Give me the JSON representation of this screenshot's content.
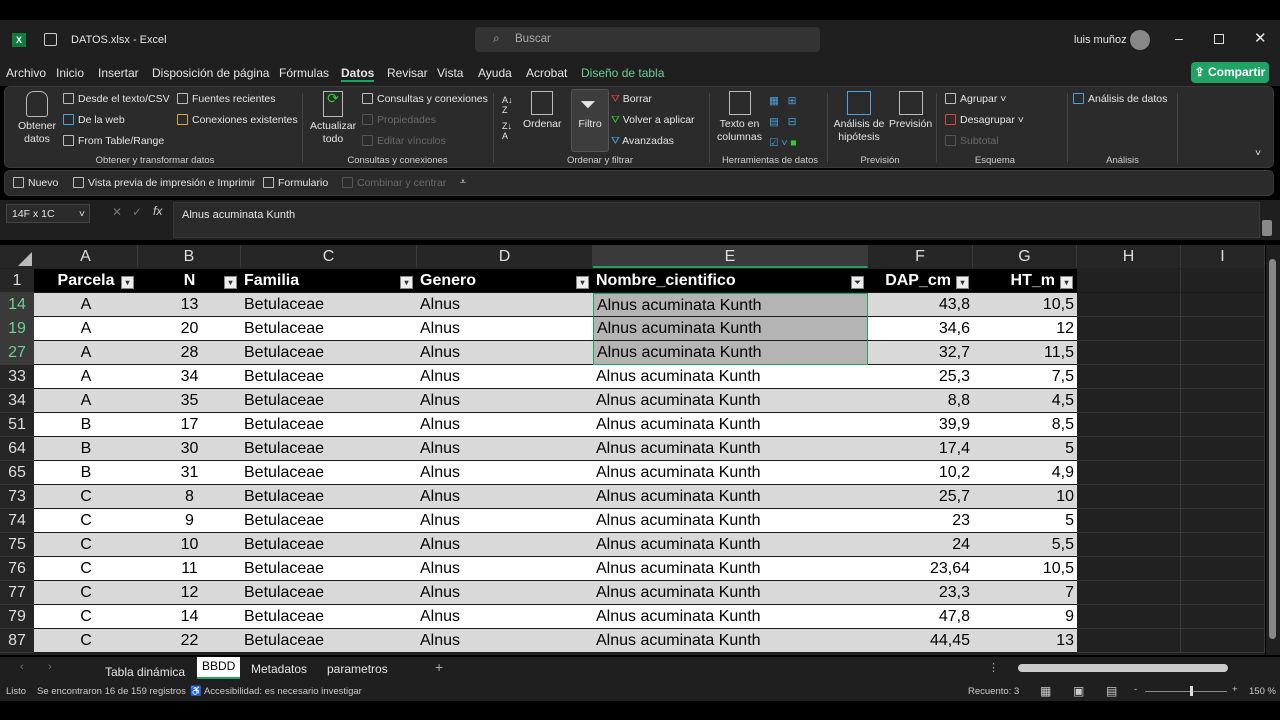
{
  "titlebar": {
    "filename": "DATOS.xlsx",
    "app": "Excel",
    "search_placeholder": "Buscar",
    "user": "luis muñoz"
  },
  "menu": [
    "Archivo",
    "Inicio",
    "Insertar",
    "Disposición de página",
    "Fórmulas",
    "Datos",
    "Revisar",
    "Vista",
    "Ayuda",
    "Acrobat",
    "Diseño de tabla"
  ],
  "share": "Compartir",
  "ribbon": {
    "obtener": "Obtener datos",
    "desde_texto": "Desde el texto/CSV",
    "de_web": "De la web",
    "from_table": "From Table/Range",
    "fuentes": "Fuentes recientes",
    "conexiones": "Conexiones existentes",
    "grp1": "Obtener y transformar datos",
    "actualizar": "Actualizar todo",
    "consultas": "Consultas y conexiones",
    "propiedades": "Propiedades",
    "editar": "Editar vínculos",
    "grp2": "Consultas y conexiones",
    "ordenar": "Ordenar",
    "filtro": "Filtro",
    "borrar": "Borrar",
    "volver": "Volver a aplicar",
    "avanzadas": "Avanzadas",
    "grp3": "Ordenar y filtrar",
    "texto_col": "Texto en columnas",
    "grp4": "Herramientas de datos",
    "hipotesis": "Análisis de hipótesis",
    "prevision": "Previsión",
    "grp5": "Previsión",
    "agrupar": "Agrupar",
    "desagrupar": "Desagrupar",
    "subtotal": "Subtotal",
    "grp6": "Esquema",
    "analisis_datos": "Análisis de datos",
    "grp7": "Análisis"
  },
  "qat": {
    "nuevo": "Nuevo",
    "vista_previa": "Vista previa de impresión e Imprimir",
    "formulario": "Formulario",
    "combinar": "Combinar y centrar"
  },
  "formula": {
    "namebox": "14F x 1C",
    "value": "Alnus acuminata Kunth"
  },
  "columns": [
    "A",
    "B",
    "C",
    "D",
    "E",
    "F",
    "G",
    "H",
    "I"
  ],
  "headers": [
    "Parcela",
    "N",
    "Familia",
    "Genero",
    "Nombre_cientifico",
    "DAP_cm",
    "HT_m"
  ],
  "rows": [
    {
      "r": "14",
      "c": [
        "A",
        "13",
        "Betulaceae",
        "Alnus",
        "Alnus acuminata Kunth",
        "43,8",
        "10,5"
      ]
    },
    {
      "r": "19",
      "c": [
        "A",
        "20",
        "Betulaceae",
        "Alnus",
        "Alnus acuminata Kunth",
        "34,6",
        "12"
      ]
    },
    {
      "r": "27",
      "c": [
        "A",
        "28",
        "Betulaceae",
        "Alnus",
        "Alnus acuminata Kunth",
        "32,7",
        "11,5"
      ]
    },
    {
      "r": "33",
      "c": [
        "A",
        "34",
        "Betulaceae",
        "Alnus",
        "Alnus acuminata Kunth",
        "25,3",
        "7,5"
      ]
    },
    {
      "r": "34",
      "c": [
        "A",
        "35",
        "Betulaceae",
        "Alnus",
        "Alnus acuminata Kunth",
        "8,8",
        "4,5"
      ]
    },
    {
      "r": "51",
      "c": [
        "B",
        "17",
        "Betulaceae",
        "Alnus",
        "Alnus acuminata Kunth",
        "39,9",
        "8,5"
      ]
    },
    {
      "r": "64",
      "c": [
        "B",
        "30",
        "Betulaceae",
        "Alnus",
        "Alnus acuminata Kunth",
        "17,4",
        "5"
      ]
    },
    {
      "r": "65",
      "c": [
        "B",
        "31",
        "Betulaceae",
        "Alnus",
        "Alnus acuminata Kunth",
        "10,2",
        "4,9"
      ]
    },
    {
      "r": "73",
      "c": [
        "C",
        "8",
        "Betulaceae",
        "Alnus",
        "Alnus acuminata Kunth",
        "25,7",
        "10"
      ]
    },
    {
      "r": "74",
      "c": [
        "C",
        "9",
        "Betulaceae",
        "Alnus",
        "Alnus acuminata Kunth",
        "23",
        "5"
      ]
    },
    {
      "r": "75",
      "c": [
        "C",
        "10",
        "Betulaceae",
        "Alnus",
        "Alnus acuminata Kunth",
        "24",
        "5,5"
      ]
    },
    {
      "r": "76",
      "c": [
        "C",
        "11",
        "Betulaceae",
        "Alnus",
        "Alnus acuminata Kunth",
        "23,64",
        "10,5"
      ]
    },
    {
      "r": "77",
      "c": [
        "C",
        "12",
        "Betulaceae",
        "Alnus",
        "Alnus acuminata Kunth",
        "23,3",
        "7"
      ]
    },
    {
      "r": "79",
      "c": [
        "C",
        "14",
        "Betulaceae",
        "Alnus",
        "Alnus acuminata Kunth",
        "47,8",
        "9"
      ]
    },
    {
      "r": "87",
      "c": [
        "C",
        "22",
        "Betulaceae",
        "Alnus",
        "Alnus acuminata Kunth",
        "44,45",
        "13"
      ]
    }
  ],
  "sheets": [
    "Tabla dinámica",
    "BBDD",
    "Metadatos",
    "parametros"
  ],
  "status": {
    "ready": "Listo",
    "found": "Se encontraron 16 de 159 registros",
    "access": "Accesibilidad: es necesario investigar",
    "count": "Recuento: 3",
    "zoom": "150 %"
  },
  "colors": {
    "accent": "#21a366",
    "band": "#d9d9d9",
    "selected": "#b4b4b4"
  }
}
